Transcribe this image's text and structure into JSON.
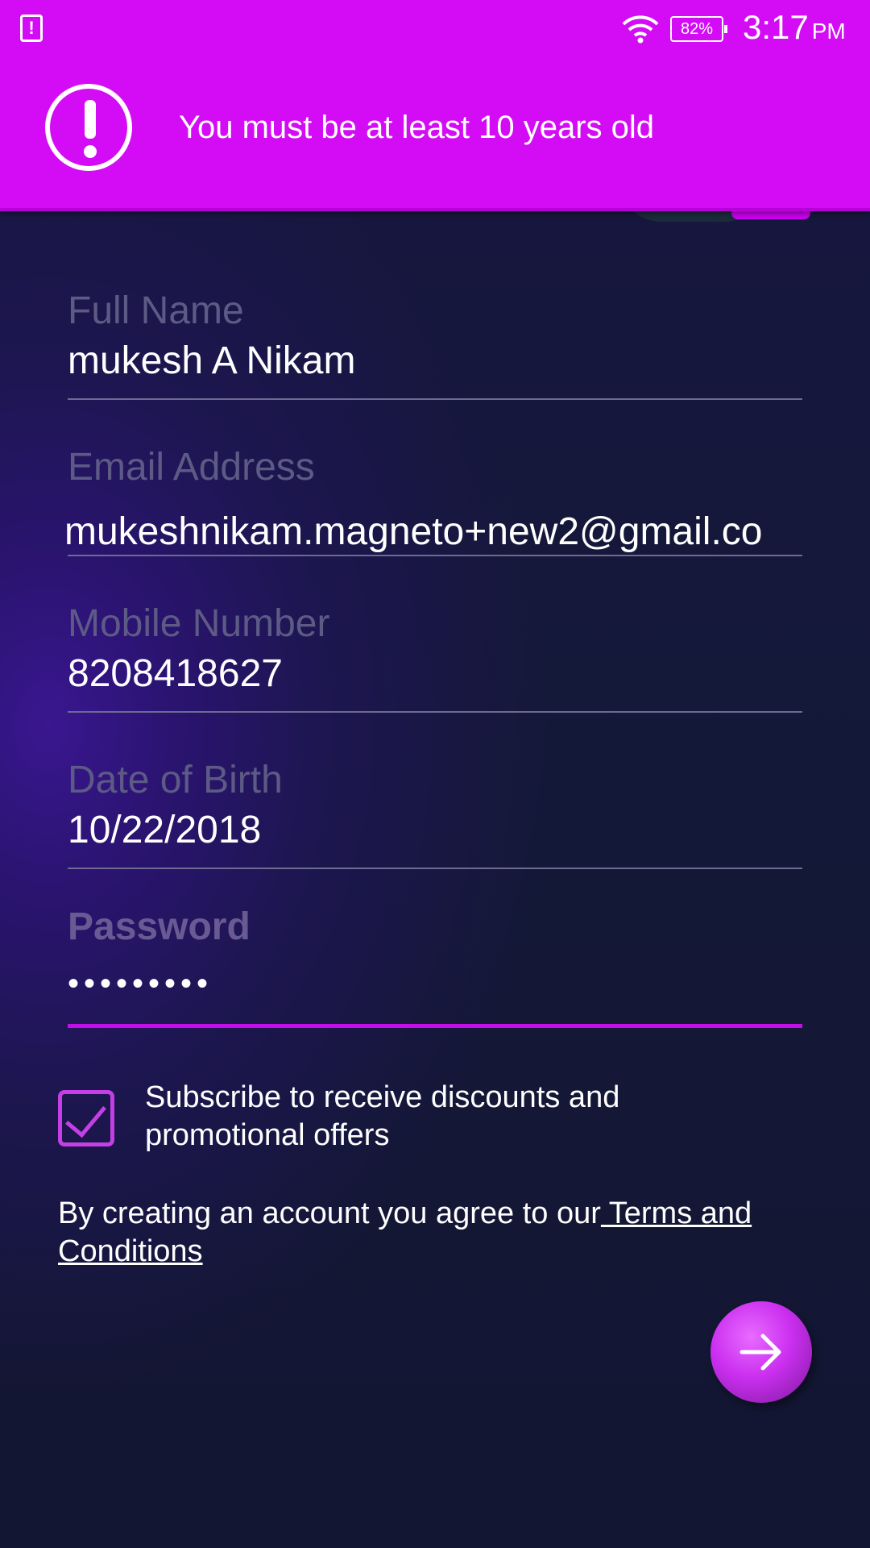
{
  "status_bar": {
    "battery": "82%",
    "time": "3:17",
    "ampm": "PM"
  },
  "banner": {
    "message": "You must be at least 10 years old",
    "color": "#d40cf5"
  },
  "form": {
    "full_name": {
      "label": "Full Name",
      "value": "mukesh A Nikam"
    },
    "email": {
      "label": "Email Address",
      "value": "mukeshnikam.magneto+new2@gmail.co"
    },
    "mobile": {
      "label": "Mobile Number",
      "value": "8208418627"
    },
    "dob": {
      "label": "Date of Birth",
      "value": "10/22/2018"
    },
    "password": {
      "label": "Password",
      "value": "•••••••••"
    }
  },
  "subscribe": {
    "checked": true,
    "text": "Subscribe to receive discounts and promotional offers"
  },
  "terms": {
    "prefix": "By creating an account you agree to our",
    "link": " Terms and Conditions"
  },
  "next_button": {
    "icon": "arrow-right-icon"
  },
  "colors": {
    "accent": "#c20ee8",
    "background": "#131632",
    "label": "#5d5a86"
  }
}
